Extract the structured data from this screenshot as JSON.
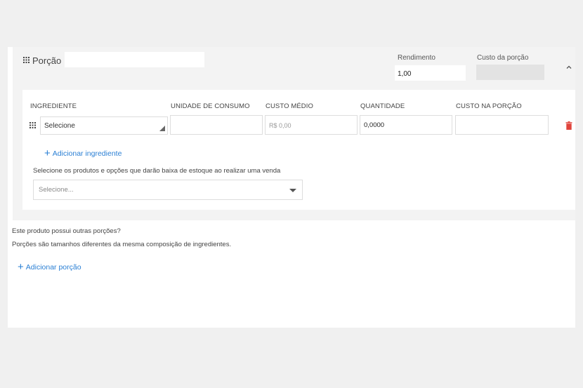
{
  "portion": {
    "label": "Porção",
    "name_value": "",
    "rendimento_label": "Rendimento",
    "rendimento_value": "1,00",
    "custo_label": "Custo da porção",
    "custo_value": ""
  },
  "table": {
    "headers": [
      "INGREDIENTE",
      "UNIDADE DE CONSUMO",
      "CUSTO MÉDIO",
      "QUANTIDADE",
      "CUSTO NA PORÇÃO"
    ],
    "row": {
      "ingrediente": "Selecione",
      "unidade": "",
      "custo_medio": "R$ 0,00",
      "quantidade": "0,0000",
      "custo_porcao": ""
    }
  },
  "actions": {
    "add_ingredient": "Adicionar ingrediente",
    "add_portion": "Adicionar porção"
  },
  "stock": {
    "label": "Selecione os produtos e opções que darão baixa de estoque ao realizar uma venda",
    "placeholder": "Selecione..."
  },
  "other_portions": {
    "question": "Este produto possui outras porções?",
    "explanation": "Porções são tamanhos diferentes da mesma composição de ingredientes."
  },
  "colors": {
    "accent": "#2a7fd4",
    "danger": "#e0443c"
  }
}
